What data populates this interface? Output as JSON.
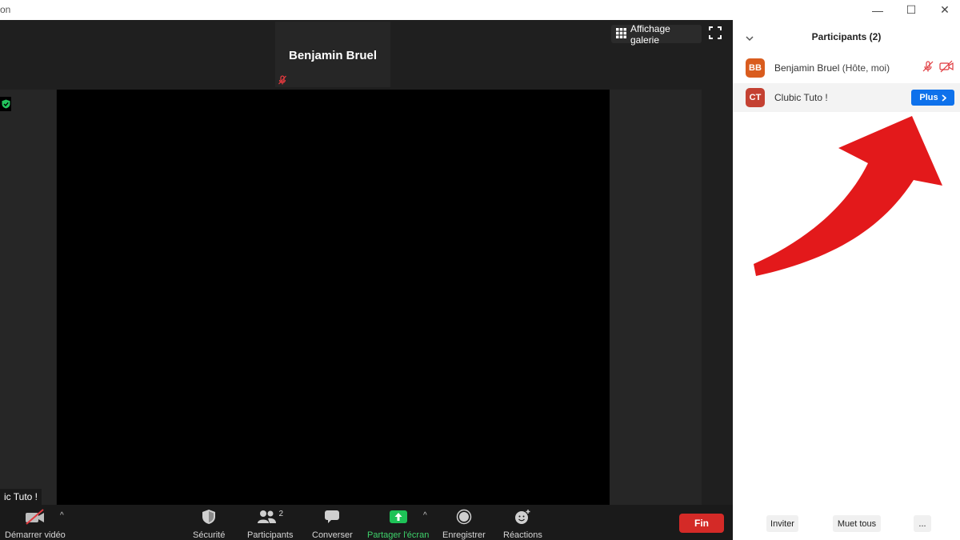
{
  "window": {
    "title_fragment": "on",
    "controls": {
      "minimize": "—",
      "maximize": "☐",
      "close": "✕"
    }
  },
  "meeting": {
    "active_speaker_name": "Benjamin Bruel",
    "gallery_button_label": "Affichage galerie",
    "name_label": "ic Tuto !"
  },
  "toolbar": {
    "video_label": "Démarrer vidéo",
    "security_label": "Sécurité",
    "participants_label": "Participants",
    "participants_count": "2",
    "chat_label": "Converser",
    "share_label": "Partager l'écran",
    "record_label": "Enregistrer",
    "reactions_label": "Réactions",
    "end_label": "Fin",
    "caret": "^"
  },
  "participants_panel": {
    "title": "Participants (2)",
    "items": [
      {
        "initials": "BB",
        "name": "Benjamin Bruel",
        "suffix": "(Hôte, moi)",
        "avatar_color": "#d95c1e"
      },
      {
        "initials": "CT",
        "name": "Clubic Tuto !",
        "suffix": "",
        "avatar_color": "#c44132",
        "action_label": "Plus"
      }
    ],
    "footer": {
      "invite_label": "Inviter",
      "mute_all_label": "Muet tous",
      "more_label": "..."
    }
  },
  "colors": {
    "accent_blue": "#0e71eb",
    "share_green": "#1ec257",
    "end_red": "#d42a27",
    "muted_red": "#e0393e",
    "arrow_red": "#e3191b"
  },
  "icons": [
    "video-off-icon",
    "shield-icon",
    "participants-icon",
    "chat-icon",
    "share-screen-icon",
    "record-icon",
    "reactions-icon",
    "gallery-grid-icon",
    "fullscreen-icon",
    "mic-muted-icon",
    "chevron-down-icon"
  ]
}
